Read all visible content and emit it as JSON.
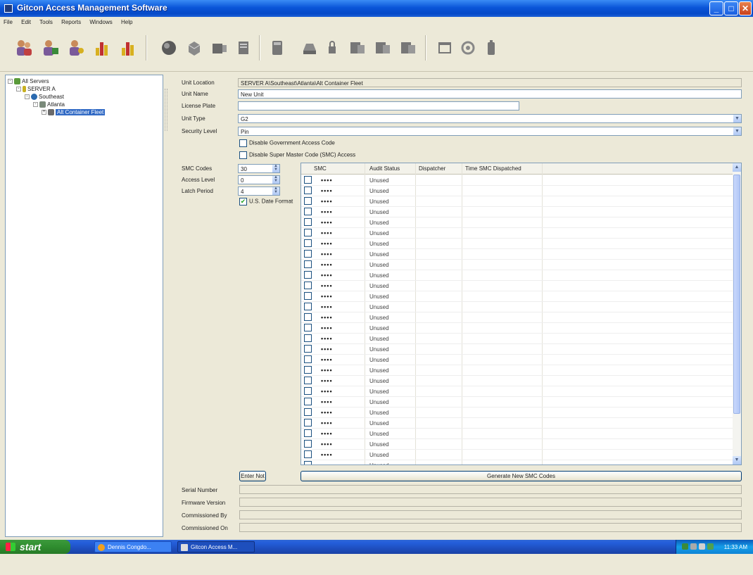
{
  "window": {
    "title": "Gitcon Access Management Software",
    "controls": {
      "minimize": "_",
      "maximize": "□",
      "close": "✕"
    }
  },
  "menu": [
    "File",
    "Edit",
    "Tools",
    "Reports",
    "Windows",
    "Help"
  ],
  "toolbar": {
    "icons": [
      "user-group-icon",
      "user-edit-icon",
      "user-key-icon",
      "report-icon",
      "report-export-icon",
      "globe-icon",
      "server-icon",
      "unit-icon",
      "document-icon",
      "calculator-icon",
      "key-icon",
      "lock-icon",
      "device-icon",
      "device-sync-icon",
      "device-list-icon",
      "window-icon",
      "settings-icon",
      "battery-icon"
    ]
  },
  "tree": {
    "items": [
      {
        "label": "All Servers",
        "level": 0,
        "expander": "-"
      },
      {
        "label": "SERVER A",
        "level": 1,
        "expander": "-"
      },
      {
        "label": "Southeast",
        "level": 2,
        "expander": "-"
      },
      {
        "label": "Atlanta",
        "level": 3,
        "expander": "-"
      },
      {
        "label": "Alt Container Fleet",
        "level": 4,
        "expander": "+",
        "selected": true
      }
    ]
  },
  "form": {
    "unit_location": {
      "label": "Unit Location",
      "value": "SERVER A\\Southeast\\Atlanta\\Alt Container Fleet"
    },
    "unit_name": {
      "label": "Unit Name",
      "value": "New Unit"
    },
    "license_plate": {
      "label": "License Plate",
      "value": ""
    },
    "unit_type": {
      "label": "Unit Type",
      "value": "G2"
    },
    "security_level": {
      "label": "Security Level",
      "value": "Pin"
    },
    "disable_gov": {
      "label": "Disable Government Access Code",
      "checked": false
    },
    "disable_smc": {
      "label": "Disable Super Master Code (SMC) Access",
      "checked": false
    },
    "smc_codes": {
      "label": "SMC Codes",
      "value": "30"
    },
    "access_level": {
      "label": "Access Level",
      "value": "0"
    },
    "latch_period": {
      "label": "Latch Period",
      "value": "4"
    },
    "us_date": {
      "label": "U.S. Date Format",
      "checked": true
    },
    "enter_not": "Enter Not",
    "generate": "Generate New SMC Codes",
    "serial_number": {
      "label": "Serial Number",
      "value": ""
    },
    "firmware_version": {
      "label": "Firmware Version",
      "value": ""
    },
    "commissioned_by": {
      "label": "Commissioned By",
      "value": ""
    },
    "commissioned_on": {
      "label": "Commissioned On",
      "value": ""
    }
  },
  "grid": {
    "columns": [
      "SMC",
      "Audit Status",
      "Dispatcher",
      "Time SMC Dispatched"
    ],
    "rows": [
      {
        "smc": "••••",
        "status": "Unused"
      },
      {
        "smc": "••••",
        "status": "Unused"
      },
      {
        "smc": "••••",
        "status": "Unused"
      },
      {
        "smc": "••••",
        "status": "Unused"
      },
      {
        "smc": "••••",
        "status": "Unused"
      },
      {
        "smc": "••••",
        "status": "Unused"
      },
      {
        "smc": "••••",
        "status": "Unused"
      },
      {
        "smc": "••••",
        "status": "Unused"
      },
      {
        "smc": "••••",
        "status": "Unused"
      },
      {
        "smc": "••••",
        "status": "Unused"
      },
      {
        "smc": "••••",
        "status": "Unused"
      },
      {
        "smc": "••••",
        "status": "Unused"
      },
      {
        "smc": "••••",
        "status": "Unused"
      },
      {
        "smc": "••••",
        "status": "Unused"
      },
      {
        "smc": "••••",
        "status": "Unused"
      },
      {
        "smc": "••••",
        "status": "Unused"
      },
      {
        "smc": "••••",
        "status": "Unused"
      },
      {
        "smc": "••••",
        "status": "Unused"
      },
      {
        "smc": "••••",
        "status": "Unused"
      },
      {
        "smc": "••••",
        "status": "Unused"
      },
      {
        "smc": "••••",
        "status": "Unused"
      },
      {
        "smc": "••••",
        "status": "Unused"
      },
      {
        "smc": "••••",
        "status": "Unused"
      },
      {
        "smc": "••••",
        "status": "Unused"
      },
      {
        "smc": "••••",
        "status": "Unused"
      },
      {
        "smc": "••••",
        "status": "Unused"
      },
      {
        "smc": "••••",
        "status": "Unused"
      },
      {
        "smc": "",
        "status": "Unused"
      }
    ]
  },
  "taskbar": {
    "start": "start",
    "tasks": [
      "Dennis Congdo...",
      "Gitcon Access M..."
    ],
    "time": "11:33 AM"
  }
}
